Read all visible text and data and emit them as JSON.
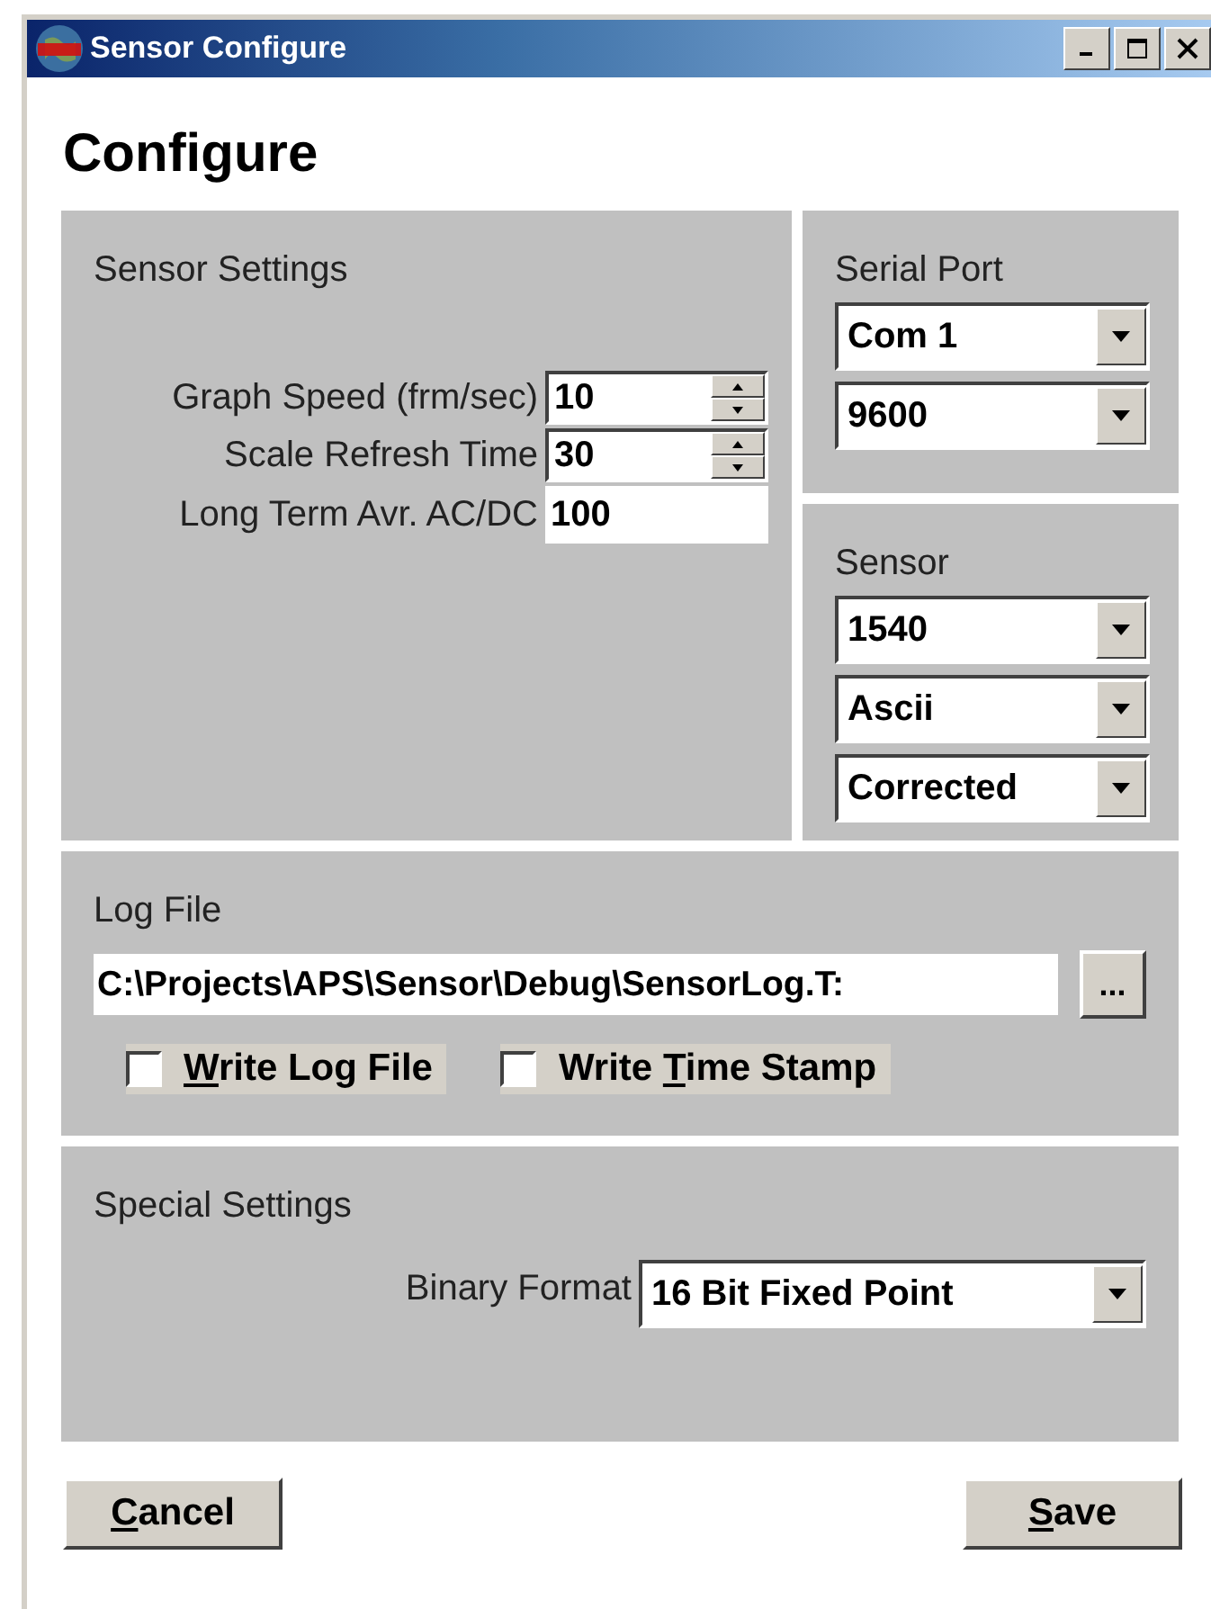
{
  "window": {
    "title": "Sensor Configure"
  },
  "heading": "Configure",
  "sensor_settings": {
    "title": "Sensor Settings",
    "fields": [
      {
        "kind": "spinner",
        "label": "Graph Speed (frm/sec)",
        "value": "10"
      },
      {
        "kind": "spinner",
        "label": "Scale Refresh Time",
        "value": "30"
      },
      {
        "kind": "text",
        "label": "Long Term Avr. AC/DC",
        "value": "100"
      }
    ]
  },
  "serial_port": {
    "title": "Serial Port",
    "dropdowns": [
      "Com 1",
      "9600"
    ]
  },
  "sensor": {
    "title": "Sensor",
    "dropdowns": [
      "1540",
      "Ascii",
      "Corrected"
    ]
  },
  "log_file": {
    "title": "Log File",
    "path": "C:\\Projects\\APS\\Sensor\\Debug\\SensorLog.T:",
    "browse": "...",
    "checkboxes": [
      {
        "label": [
          {
            "text": "W",
            "underline": true
          },
          {
            "text": "rite Log File",
            "underline": false
          }
        ],
        "checked": false
      },
      {
        "label": [
          {
            "text": "Write ",
            "underline": false
          },
          {
            "text": "T",
            "underline": true
          },
          {
            "text": "ime Stamp",
            "underline": false
          }
        ],
        "checked": false
      }
    ]
  },
  "special_settings": {
    "title": "Special Settings",
    "binary_format_label": "Binary Format",
    "binary_format": "16 Bit Fixed Point"
  },
  "buttons": [
    {
      "label": [
        {
          "text": "C",
          "underline": true
        },
        {
          "text": "ancel",
          "underline": false
        }
      ]
    },
    {
      "label": [
        {
          "text": "S",
          "underline": true
        },
        {
          "text": "ave",
          "underline": false
        }
      ]
    }
  ]
}
